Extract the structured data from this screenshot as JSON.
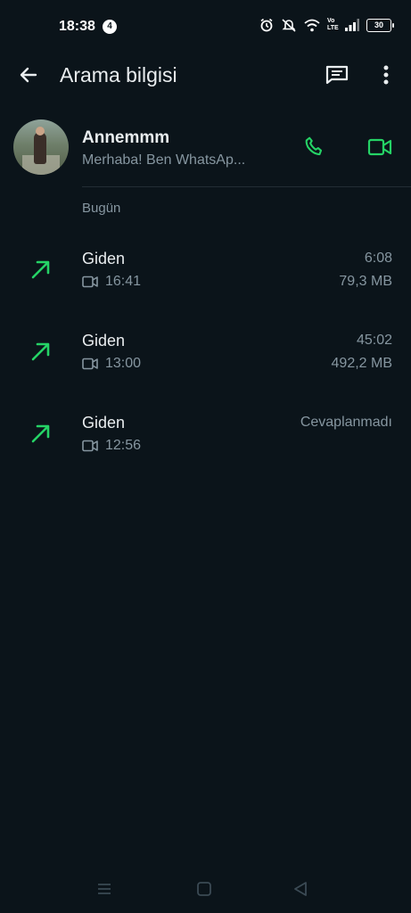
{
  "status_bar": {
    "time": "18:38",
    "notification_count": "4",
    "volte_label": "Vo LTE",
    "battery": "30"
  },
  "app_bar": {
    "title": "Arama bilgisi"
  },
  "contact": {
    "name": "Annemmm",
    "status": "Merhaba! Ben WhatsAp..."
  },
  "section": {
    "label": "Bugün"
  },
  "calls": [
    {
      "direction": "Giden",
      "time": "16:41",
      "duration": "6:08",
      "size": "79,3 MB"
    },
    {
      "direction": "Giden",
      "time": "13:00",
      "duration": "45:02",
      "size": "492,2 MB"
    },
    {
      "direction": "Giden",
      "time": "12:56",
      "duration": "Cevaplanmadı",
      "size": ""
    }
  ],
  "colors": {
    "background": "#0b141a",
    "accent_green": "#25d366",
    "secondary_text": "#8696a0",
    "primary_text": "#e9edef"
  },
  "icons": [
    "back-arrow-icon",
    "message-icon",
    "more-vert-icon",
    "phone-icon",
    "video-camera-icon",
    "outgoing-arrow-icon",
    "video-small-icon"
  ]
}
